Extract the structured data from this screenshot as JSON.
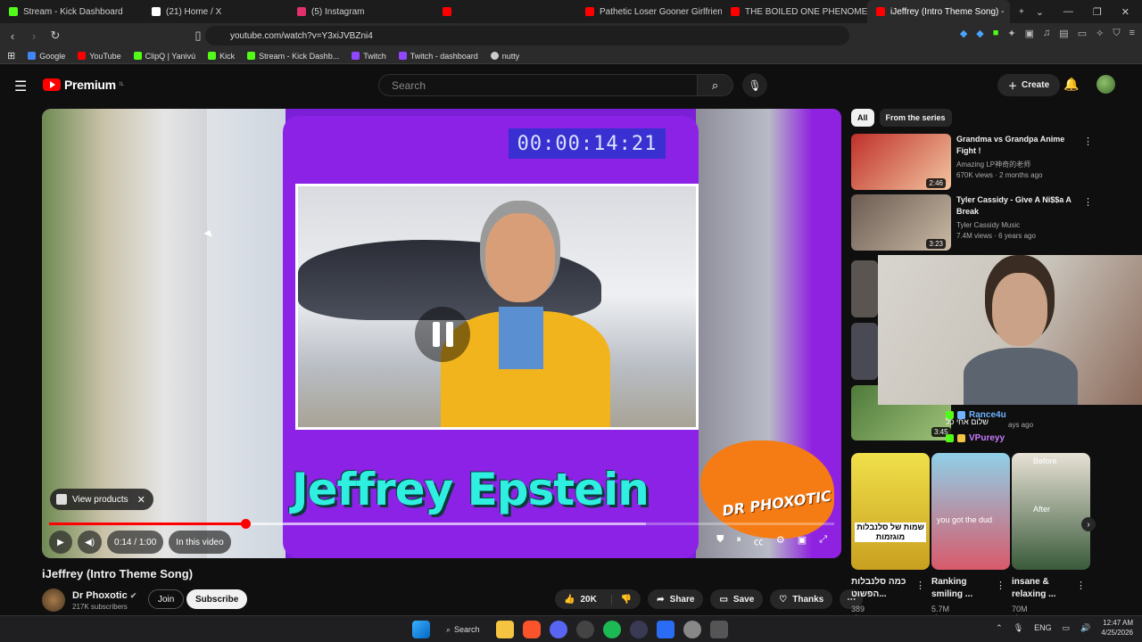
{
  "browser": {
    "tabs": [
      {
        "label": "Stream - Kick Dashboard",
        "color": "#53fc18"
      },
      {
        "label": "(21) Home / X",
        "color": "#ffffff"
      },
      {
        "label": "(5) Instagram",
        "color": "#e1306c"
      },
      {
        "label": "",
        "color": "#ff0000"
      },
      {
        "label": "Pathetic Loser Gooner Girlfriend Beg",
        "color": "#ff0000"
      },
      {
        "label": "THE BOILED ONE PHENOMENON - Y",
        "color": "#ff0000"
      },
      {
        "label": "iJeffrey (Intro Theme Song) -",
        "color": "#ff0000",
        "active": true
      }
    ],
    "new_tab": "+",
    "url": "youtube.com/watch?v=Y3xiJVBZni4",
    "bookmarks": [
      {
        "label": "Google",
        "color": "#4285f4"
      },
      {
        "label": "YouTube",
        "color": "#ff0000"
      },
      {
        "label": "ClipQ | Yanivú",
        "color": "#53fc18"
      },
      {
        "label": "Kick",
        "color": "#53fc18"
      },
      {
        "label": "Stream - Kick Dashb...",
        "color": "#53fc18"
      },
      {
        "label": "Twitch",
        "color": "#9146ff"
      },
      {
        "label": "Twitch - dashboard",
        "color": "#9146ff"
      },
      {
        "label": "nutty",
        "color": "#cccccc"
      }
    ]
  },
  "youtube": {
    "logo_text": "Premium",
    "logo_region": "IL",
    "search_placeholder": "Search",
    "create_label": "Create"
  },
  "player": {
    "timecode": "00:00:14:21",
    "caption": "Jeffrey Epstein",
    "brand": "DR PHOXOTIC",
    "view_products": "View products",
    "time": "0:14 / 1:00",
    "in_this_video": "In this video",
    "progress_fraction": 0.25,
    "buffer_fraction": 0.76
  },
  "video": {
    "title": "iJeffrey (Intro Theme Song)",
    "channel": "Dr Phoxotic",
    "subscribers": "217K subscribers",
    "join": "Join",
    "subscribe": "Subscribe",
    "likes": "20K",
    "share": "Share",
    "save": "Save",
    "thanks": "Thanks"
  },
  "sidebar": {
    "chips": [
      "All",
      "From the series"
    ],
    "recommendations": [
      {
        "title": "Grandma vs Grandpa Anime Fight !",
        "channel": "Amazing LP神奇的老师",
        "meta": "670K views · 2 months ago",
        "duration": "2:46",
        "color": "#c0302a"
      },
      {
        "title": "Tyler Cassidy - Give A Ni$$a A Break",
        "channel": "Tyler Cassidy Music",
        "meta": "7.4M views · 6 years ago",
        "duration": "3:23",
        "color": "#6b5b52"
      }
    ],
    "partial_duration": "3:45",
    "partial_meta": "ays ago",
    "chat": [
      {
        "user": "Rance4u",
        "color": "#6fb3ff"
      },
      {
        "user": "VPureyy",
        "color": "#c77dff"
      }
    ],
    "chat_text": "שלום אחי כל",
    "shorts": [
      {
        "title": "כמה סלנבלות הפשוט...",
        "views": "389 views",
        "overlay": "שמות של סלנבלות מוגזמות",
        "color": "#e6c93a"
      },
      {
        "title": "Ranking smiling ...",
        "views": "5.7M views",
        "overlay": "you got the dud",
        "color": "#d85a6b"
      },
      {
        "title": "insane & relaxing ...",
        "views": "70M views",
        "overlay_top": "Before",
        "overlay_mid": "After",
        "color": "#3a5a3a"
      }
    ]
  },
  "taskbar": {
    "search": "Search",
    "lang": "ENG",
    "time": "12:47 AM",
    "date": "4/25/2026"
  }
}
